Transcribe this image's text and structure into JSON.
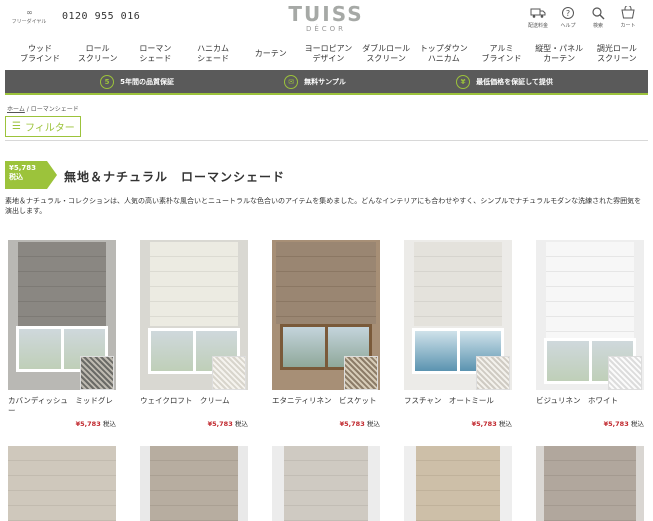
{
  "header": {
    "free_dial_icon": "∞",
    "free_dial_label": "フリーダイヤル",
    "phone": "0120 955 016",
    "logo_main": "TUISS",
    "logo_sub": "DÉCOR",
    "utils": [
      {
        "label": "配送料金",
        "icon": "truck-icon"
      },
      {
        "label": "ヘルプ",
        "icon": "help-icon"
      },
      {
        "label": "検索",
        "icon": "search-icon"
      },
      {
        "label": "カート",
        "icon": "cart-icon"
      }
    ]
  },
  "nav": [
    "ウッド\nブラインド",
    "ロール\nスクリーン",
    "ローマン\nシェード",
    "ハニカム\nシェード",
    "カーテン",
    "ヨーロピアン\nデザイン",
    "ダブルロール\nスクリーン",
    "トップダウン\nハニカム",
    "アルミ\nブラインド",
    "縦型・パネル\nカーテン",
    "調光ロール\nスクリーン"
  ],
  "promo": [
    {
      "icon": "5",
      "text": "5年間の品質保証"
    },
    {
      "icon": "✉",
      "text": "無料サンプル"
    },
    {
      "icon": "¥",
      "text": "最低価格を保証して提供"
    }
  ],
  "breadcrumb": {
    "home": "ホーム",
    "sep": "/",
    "current": "ローマンシェード"
  },
  "filter_label": "フィルター",
  "price_tag": {
    "amount": "¥5,783",
    "suffix": "税込"
  },
  "title": "無地＆ナチュラル　ローマンシェード",
  "intro": "素地＆ナチュラル・コレクションは、人気の高い素朴な風合いとニュートラルな色合いのアイテムを集めました。どんなインテリアにも合わせやすく、シンプルでナチュラルモダンな洗練された雰囲気を演出します。",
  "products": [
    {
      "name": "カバンディッシュ　ミッドグレー",
      "price": "¥5,783",
      "tax": "税込",
      "colors": {
        "shade": "#8a8782",
        "bg": "#b9b8b4"
      }
    },
    {
      "name": "ウェイクロフト　クリーム",
      "price": "¥5,783",
      "tax": "税込",
      "colors": {
        "shade": "#ecebe2",
        "bg": "#d9d8d2"
      }
    },
    {
      "name": "エタニティリネン　ビスケット",
      "price": "¥5,783",
      "tax": "税込",
      "colors": {
        "shade": "#9a8672",
        "bg": "#a78f76"
      }
    },
    {
      "name": "フスチャン　オートミール",
      "price": "¥5,783",
      "tax": "税込",
      "colors": {
        "shade": "#e4e2dc",
        "bg": "#ecebe8"
      }
    },
    {
      "name": "ビジュリネン　ホワイト",
      "price": "¥5,783",
      "tax": "税込",
      "colors": {
        "shade": "#f5f5f5",
        "bg": "#eeeeee"
      }
    }
  ],
  "row2_colors": [
    "#cfc8bc",
    "#b7ada0",
    "#cfcac2",
    "#cdbfa8",
    "#b1a79d"
  ],
  "accent": "#9cc33b",
  "promo_bg": "#5a5a5a",
  "price_color": "#c0272d"
}
